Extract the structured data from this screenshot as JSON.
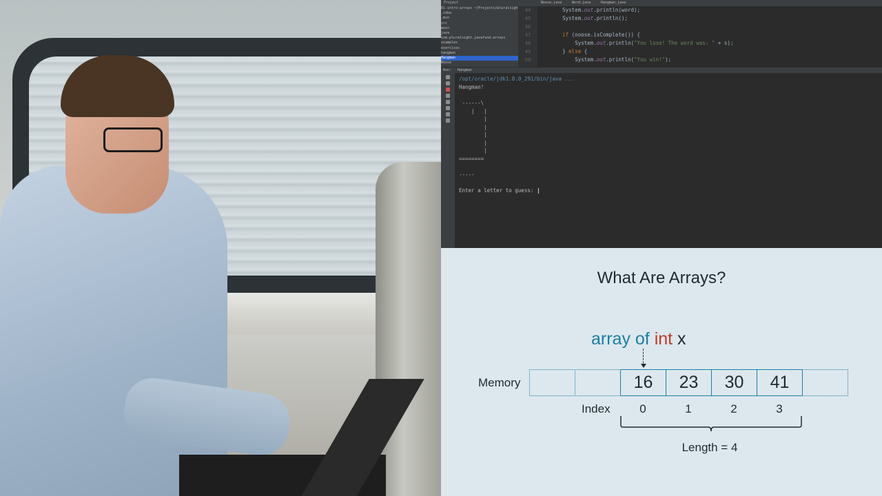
{
  "ide": {
    "project_tool": "Project",
    "tabs": [
      "Noose.java",
      "Word.java",
      "Hangman.java"
    ],
    "project_tree": [
      "01-intro-arrays  ~/Projects/pluralsight",
      "  .idea",
      "  .mvn",
      "  src",
      "    main",
      "      java",
      "        com.pluralsight.javafund.arrays",
      "          examples",
      "          exercises",
      "          hangman",
      "            Hangman",
      "            Noose"
    ],
    "selected_tree_item": "            Hangman",
    "line_numbers": [
      "44",
      "45",
      "46",
      "47",
      "48",
      "49",
      "50"
    ],
    "code_lines": [
      {
        "indent": "        ",
        "parts": [
          [
            "plain",
            "System."
          ],
          [
            "fld",
            "out"
          ],
          [
            "plain",
            ".println(word);"
          ]
        ]
      },
      {
        "indent": "        ",
        "parts": [
          [
            "plain",
            "System."
          ],
          [
            "fld",
            "out"
          ],
          [
            "plain",
            ".println();"
          ]
        ]
      },
      {
        "indent": "",
        "parts": []
      },
      {
        "indent": "        ",
        "parts": [
          [
            "kw",
            "if "
          ],
          [
            "plain",
            "(noose.isComplete()) {"
          ]
        ]
      },
      {
        "indent": "            ",
        "parts": [
          [
            "plain",
            "System."
          ],
          [
            "fld",
            "out"
          ],
          [
            "plain",
            ".println("
          ],
          [
            "str",
            "\"You lose! The word was: \""
          ],
          [
            "plain",
            " + s);"
          ]
        ]
      },
      {
        "indent": "        ",
        "parts": [
          [
            "plain",
            "} "
          ],
          [
            "kw",
            "else "
          ],
          [
            "plain",
            "{"
          ]
        ]
      },
      {
        "indent": "            ",
        "parts": [
          [
            "plain",
            "System."
          ],
          [
            "fld",
            "out"
          ],
          [
            "plain",
            ".println("
          ],
          [
            "str",
            "\"You win!\""
          ],
          [
            "plain",
            ");"
          ]
        ]
      }
    ],
    "run_tool": "Run:",
    "run_tab": "Hangman",
    "console_command": "/opt/oracle/jdk1.8.0_291/bin/java ...",
    "console_lines": [
      "Hangman!",
      "",
      " ------\\",
      "    |   |",
      "        |",
      "        |",
      "        |",
      "        |",
      "        |",
      "========",
      "",
      "-----",
      "",
      "Enter a letter to guess: "
    ]
  },
  "slide": {
    "title": "What Are Arrays?",
    "declaration": {
      "part1": "array of ",
      "part2": "int",
      "part3": " x"
    },
    "memory_label": "Memory",
    "index_label": "Index",
    "values": [
      "16",
      "23",
      "30",
      "41"
    ],
    "indices": [
      "0",
      "1",
      "2",
      "3"
    ],
    "length_label": "Length = 4",
    "colors": {
      "accent": "#1a7ea4",
      "type_red": "#c0392b",
      "background": "#dde8ee"
    }
  }
}
